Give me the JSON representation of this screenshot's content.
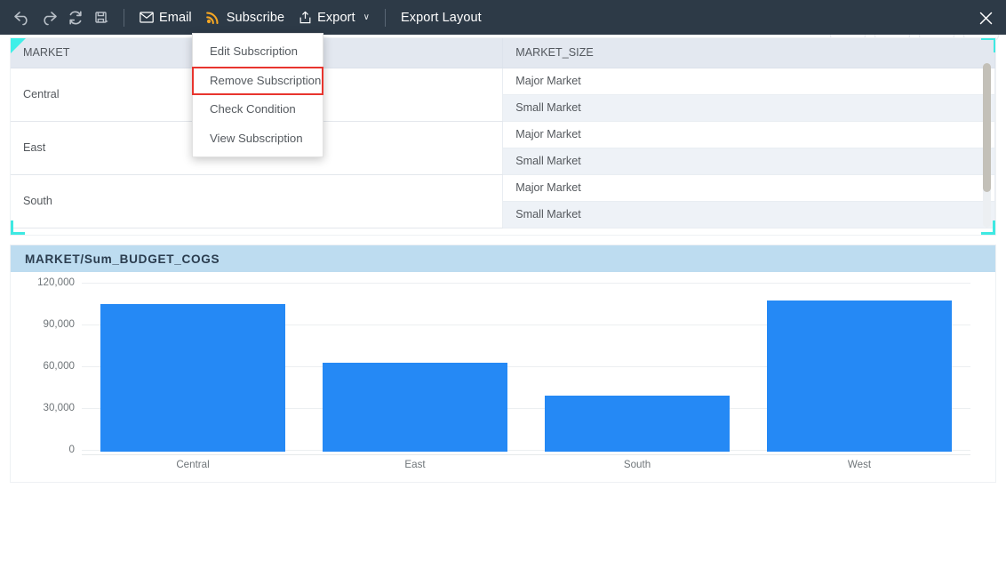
{
  "toolbar": {
    "icons": [
      {
        "name": "undo-icon",
        "label": "Undo"
      },
      {
        "name": "redo-icon",
        "label": "Redo"
      },
      {
        "name": "refresh-icon",
        "label": "Refresh"
      },
      {
        "name": "save-export-icon",
        "label": "Save"
      }
    ],
    "email_label": "Email",
    "subscribe_label": "Subscribe",
    "export_label": "Export",
    "export_caret": "∨",
    "export_layout_label": "Export Layout",
    "close_label": "✕",
    "accent_color": "#f5a623",
    "background_color": "#2d3a47"
  },
  "menu": {
    "items": [
      {
        "label": "Edit Subscription",
        "highlighted": false
      },
      {
        "label": "Remove Subscription",
        "highlighted": true
      },
      {
        "label": "Check Condition",
        "highlighted": false
      },
      {
        "label": "View Subscription",
        "highlighted": false
      }
    ],
    "highlight_color": "#e8352e"
  },
  "grid": {
    "columns": [
      "MARKET",
      "MARKET_SIZE"
    ],
    "rows": [
      {
        "market": "Central",
        "sizes": [
          "Major Market",
          "Small Market"
        ]
      },
      {
        "market": "East",
        "sizes": [
          "Major Market",
          "Small Market"
        ]
      },
      {
        "market": "South",
        "sizes": [
          "Major Market",
          "Small Market"
        ]
      }
    ],
    "selection_color": "#3ee9e2"
  },
  "chart_panel": {
    "title": "MARKET/Sum_BUDGET_COGS"
  },
  "chart_data": {
    "type": "bar",
    "title": "MARKET/Sum_BUDGET_COGS",
    "categories": [
      "Central",
      "East",
      "South",
      "West"
    ],
    "values": [
      106000,
      64000,
      40500,
      108500
    ],
    "series": [
      {
        "name": "Sum_BUDGET_COGS",
        "values": [
          106000,
          64000,
          40500,
          108500
        ]
      }
    ],
    "xlabel": "",
    "ylabel": "",
    "ylim": [
      0,
      120000
    ],
    "yticks": [
      0,
      30000,
      60000,
      90000,
      120000
    ],
    "ytick_labels": [
      "0",
      "30,000",
      "60,000",
      "90,000",
      "120,000"
    ],
    "grid": true,
    "legend": false,
    "bar_color": "#2589f5"
  }
}
